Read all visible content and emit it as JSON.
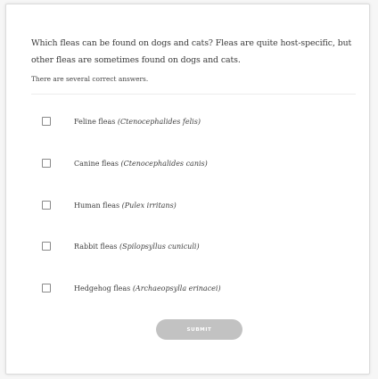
{
  "quiz": {
    "question": "Which fleas can be found on dogs and cats? Fleas are quite host-specific, but other fleas are sometimes found on dogs and cats.",
    "hint": "There are several correct answers.",
    "options": [
      {
        "name": "Feline fleas",
        "latin": "(Ctenocephalides felis)",
        "checked": false
      },
      {
        "name": "Canine fleas",
        "latin": "(Ctenocephalides canis)",
        "checked": false
      },
      {
        "name": "Human fleas",
        "latin": "(Pulex irritans)",
        "checked": false
      },
      {
        "name": "Rabbit fleas",
        "latin": "(Spilopsyllus cuniculi)",
        "checked": false
      },
      {
        "name": "Hedgehog fleas",
        "latin": "(Archaeopsylla erinacei)",
        "checked": false
      }
    ],
    "submit_label": "SUBMIT"
  },
  "colors": {
    "card_background": "#ffffff",
    "page_background": "#f6f6f6",
    "submit_disabled": "#c2c2c2",
    "text": "#333333"
  }
}
